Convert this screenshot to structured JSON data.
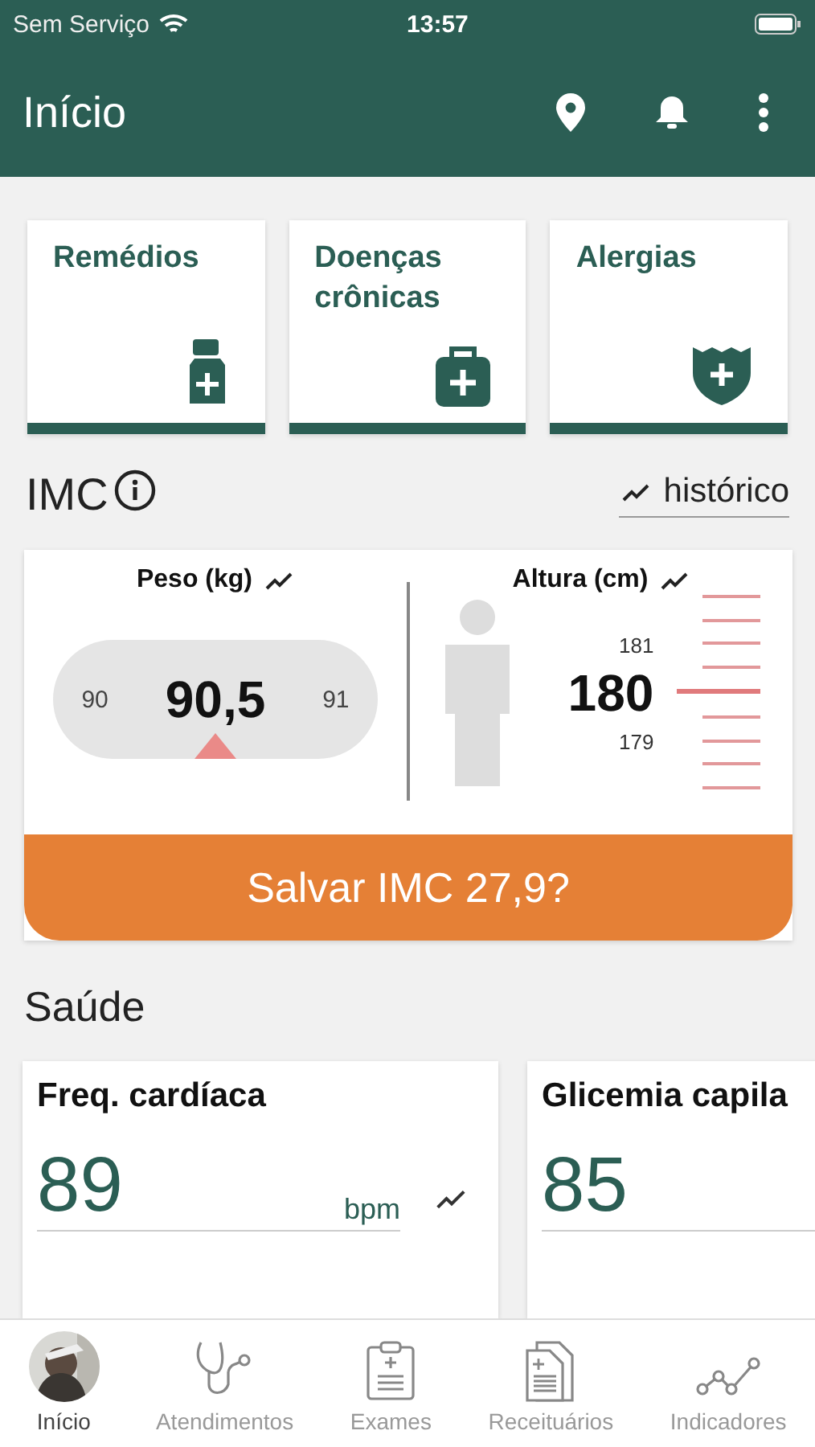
{
  "status_bar": {
    "carrier": "Sem Serviço",
    "time": "13:57"
  },
  "header": {
    "title": "Início"
  },
  "shortcuts": [
    {
      "label": "Remédios",
      "kind": "bottle"
    },
    {
      "label": "Doenças crônicas",
      "kind": "kit"
    },
    {
      "label": "Alergias",
      "kind": "shield"
    }
  ],
  "imc": {
    "title": "IMC",
    "history_link": "histórico",
    "weight": {
      "label": "Peso (kg)",
      "prev": "90",
      "value": "90,5",
      "next": "91"
    },
    "height": {
      "label": "Altura (cm)",
      "above": "181",
      "value": "180",
      "below": "179"
    },
    "save_button": "Salvar IMC 27,9?"
  },
  "health": {
    "title": "Saúde",
    "cards": [
      {
        "title": "Freq. cardíaca",
        "value": "89",
        "unit": "bpm",
        "trend": true
      },
      {
        "title": "Glicemia capila",
        "value": "85"
      }
    ]
  },
  "tabs": [
    {
      "label": "Início",
      "kind": "avatar",
      "selected": true
    },
    {
      "label": "Atendimentos",
      "kind": "stethoscope",
      "selected": false
    },
    {
      "label": "Exames",
      "kind": "clipboard",
      "selected": false
    },
    {
      "label": "Receituários",
      "kind": "documents",
      "selected": false
    },
    {
      "label": "Indicadores",
      "kind": "chart",
      "selected": false
    }
  ]
}
